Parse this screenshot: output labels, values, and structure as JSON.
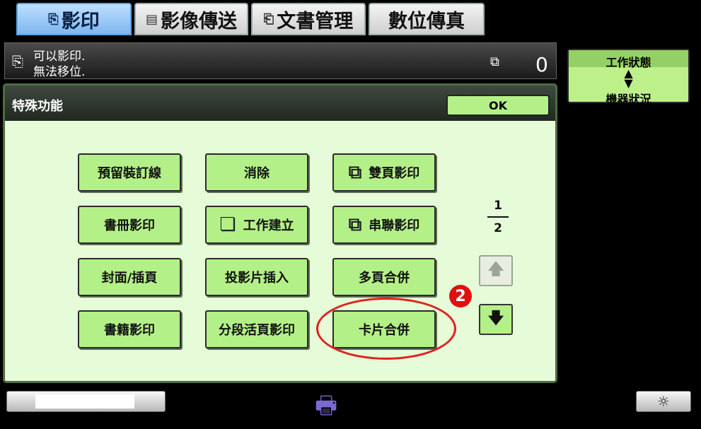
{
  "tabs": [
    {
      "label": "影印",
      "icon": "copy-icon",
      "active": true
    },
    {
      "label": "影像傳送",
      "icon": "image-send-icon",
      "active": false
    },
    {
      "label": "文書管理",
      "icon": "document-filing-icon",
      "active": false
    },
    {
      "label": "數位傳真",
      "icon": "",
      "active": false
    }
  ],
  "status": {
    "line1": "可以影印.",
    "line2": "無法移位.",
    "copies": "0"
  },
  "job_status": {
    "top": "工作狀態",
    "bottom": "機器狀況"
  },
  "special": {
    "title": "特殊功能",
    "ok_label": "OK",
    "buttons": {
      "margin_shift": "預留裝訂線",
      "erase": "消除",
      "dual_page_copy": "雙頁影印",
      "booklet_copy": "書冊影印",
      "job_build": "工作建立",
      "tandem_copy": "串聯影印",
      "covers_inserts": "封面/插頁",
      "transparency_inserts": "投影片插入",
      "multi_shot": "多頁合併",
      "book_copy": "書籍影印",
      "pamphlet_copy": "分段活頁影印",
      "card_shot": "卡片合併"
    },
    "page_current": "1",
    "page_total": "2",
    "callout_number": "2"
  }
}
